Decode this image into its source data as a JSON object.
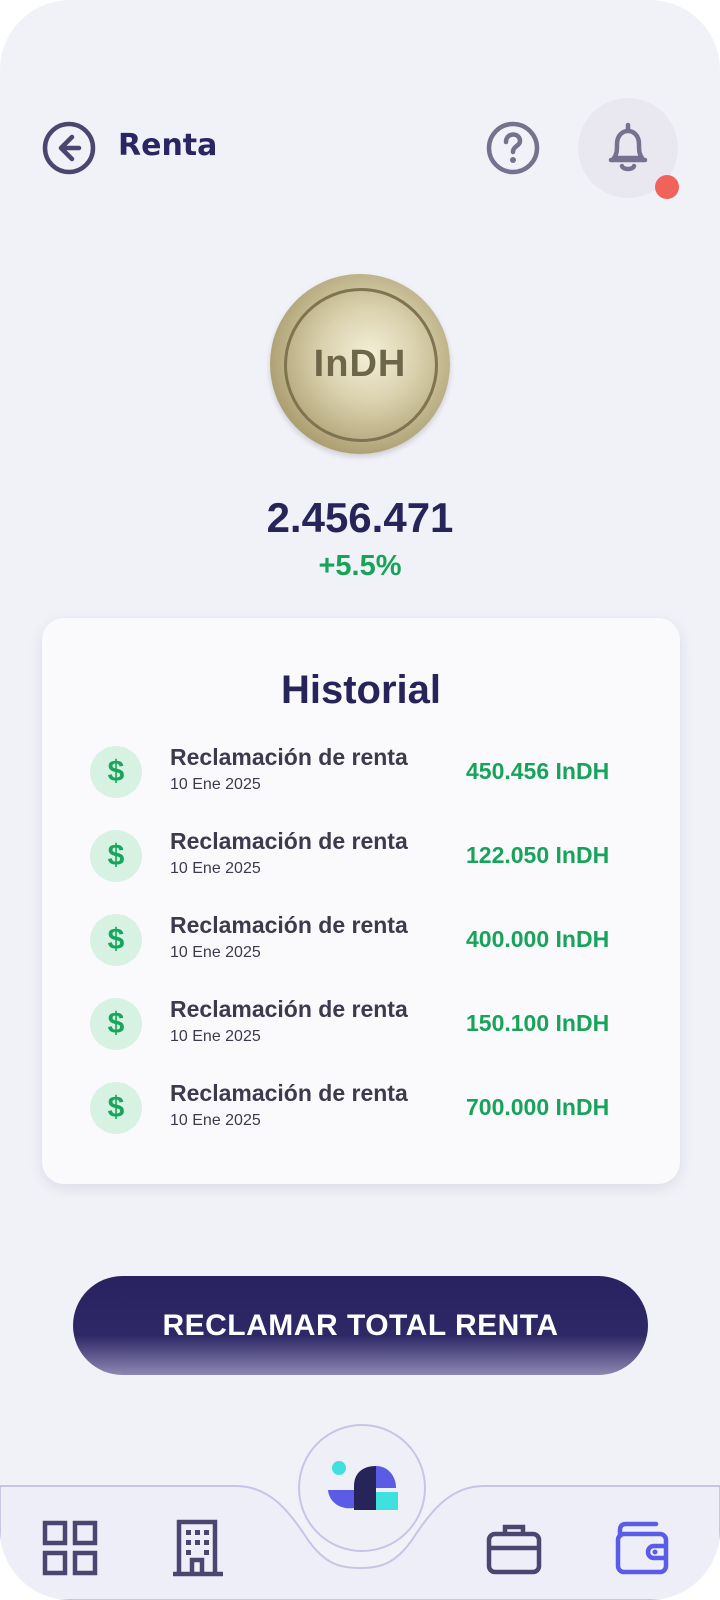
{
  "header": {
    "title": "Renta",
    "back_icon": "arrow-left-circle-icon",
    "help_icon": "help-circle-icon",
    "notification_icon": "bell-icon",
    "notification_dot_color": "#f0625a"
  },
  "coin": {
    "label": "InDH"
  },
  "balance": {
    "value": "2.456.471",
    "change": "+5.5%",
    "change_color": "#17a35a"
  },
  "history": {
    "title": "Historial",
    "items": [
      {
        "title": "Reclamación de renta",
        "date": "10 Ene 2025",
        "amount": "450.456 InDH",
        "icon": "$"
      },
      {
        "title": "Reclamación de renta",
        "date": "10 Ene 2025",
        "amount": "122.050 InDH",
        "icon": "$"
      },
      {
        "title": "Reclamación de renta",
        "date": "10 Ene 2025",
        "amount": "400.000 InDH",
        "icon": "$"
      },
      {
        "title": "Reclamación de renta",
        "date": "10 Ene 2025",
        "amount": "150.100 InDH",
        "icon": "$"
      },
      {
        "title": "Reclamación de renta",
        "date": "10 Ene 2025",
        "amount": "700.000 InDH",
        "icon": "$"
      }
    ]
  },
  "actions": {
    "claim_label": "RECLAMAR TOTAL RENTA"
  },
  "bottom_nav": {
    "items": [
      {
        "name": "dashboard",
        "icon": "grid-icon",
        "active": false
      },
      {
        "name": "buildings",
        "icon": "building-icon",
        "active": false
      },
      {
        "name": "home",
        "icon": "logo-icon",
        "active": false
      },
      {
        "name": "portfolio",
        "icon": "briefcase-icon",
        "active": false
      },
      {
        "name": "wallet",
        "icon": "wallet-icon",
        "active": true
      }
    ],
    "accent_color": "#5b5ce6",
    "default_color": "#4b4670"
  }
}
